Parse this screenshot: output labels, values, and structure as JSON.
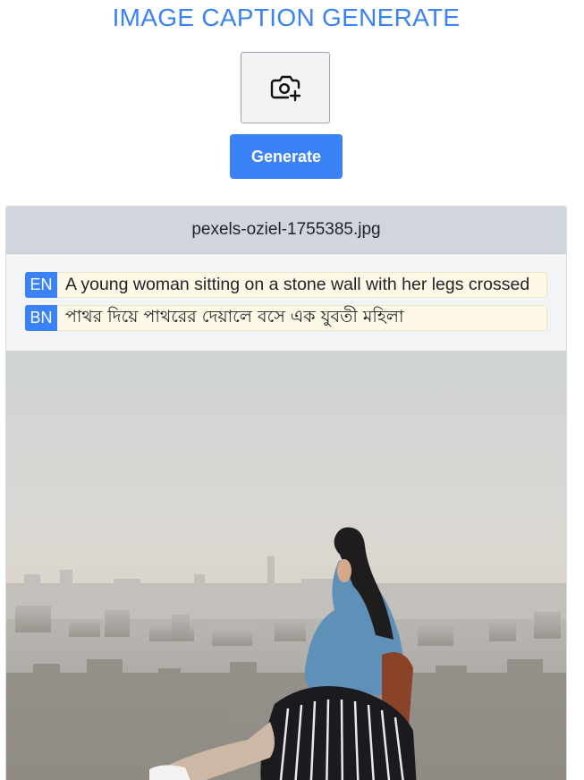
{
  "app": {
    "title": "IMAGE CAPTION GENERATE"
  },
  "upload": {
    "icon": "camera-plus-icon"
  },
  "actions": {
    "generate_label": "Generate"
  },
  "result": {
    "filename": "pexels-oziel-1755385.jpg",
    "captions": [
      {
        "lang": "EN",
        "text": "A young woman sitting on a stone wall with her legs crossed"
      },
      {
        "lang": "BN",
        "text": "পাথর দিয়ে পাথরের দেয়ালে বসে এক যুবতী মহিলা"
      }
    ]
  },
  "colors": {
    "accent": "#3b82f6",
    "caption_bg": "#fef9e7",
    "header_bg": "#d1d5dc"
  }
}
